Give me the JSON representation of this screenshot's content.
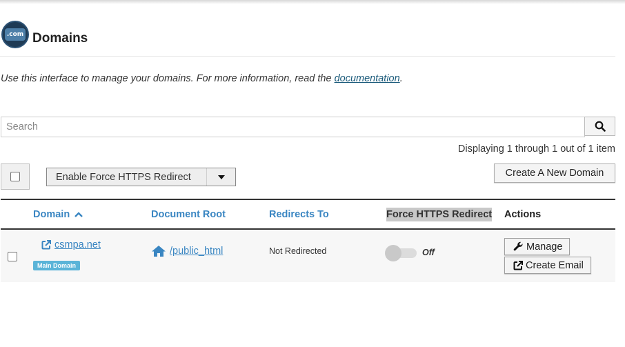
{
  "header": {
    "logo_text": ".com",
    "title": "Domains"
  },
  "intro": {
    "text": "Use this interface to manage your domains. For more information, read the ",
    "link": "documentation",
    "suffix": "."
  },
  "search": {
    "placeholder": "Search",
    "value": ""
  },
  "pagination": {
    "status": "Displaying 1 through 1 out of 1 item"
  },
  "toolbar": {
    "bulk_action_selected": "Enable Force HTTPS Redirect",
    "create_button": "Create A New Domain"
  },
  "table": {
    "headers": {
      "domain": "Domain",
      "document_root": "Document Root",
      "redirects_to": "Redirects To",
      "force_https": "Force HTTPS Redirect",
      "actions": "Actions"
    },
    "rows": [
      {
        "domain": "csmpa.net",
        "badge": "Main Domain",
        "document_root": "/public_html",
        "redirects_to": "Not Redirected",
        "force_https_state": "Off",
        "actions": {
          "manage": "Manage",
          "create_email": "Create Email"
        }
      }
    ]
  },
  "colors": {
    "link_blue": "#3a86c2",
    "badge_blue": "#5ab4d8",
    "logo_navy": "#1f3b55"
  },
  "icons": {
    "search": "search-icon",
    "external_link": "external-link-icon",
    "home": "home-icon",
    "wrench": "wrench-icon",
    "sort_up": "chevron-up-icon",
    "dropdown": "caret-down-icon"
  }
}
